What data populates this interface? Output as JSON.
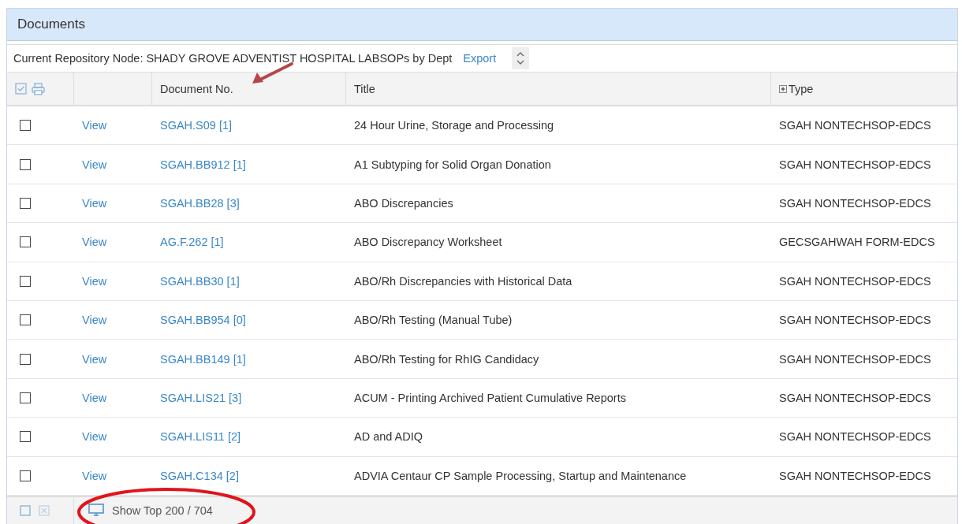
{
  "panel": {
    "title": "Documents"
  },
  "toolbar": {
    "node_label": "Current Repository Node: SHADY GROVE ADVENTIST HOSPITAL LABSOPs by Dept",
    "export_link": "Export"
  },
  "table": {
    "columns": [
      "Document No.",
      "Title",
      "Type"
    ],
    "rows": [
      {
        "checked": false,
        "action": "View",
        "doc_no": "SGAH.S09 [1]",
        "title": "24 Hour Urine, Storage and Processing",
        "type": "SGAH NONTECHSOP-EDCS"
      },
      {
        "checked": false,
        "action": "View",
        "doc_no": "SGAH.BB912 [1]",
        "title": "A1 Subtyping for Solid Organ Donation",
        "type": "SGAH NONTECHSOP-EDCS"
      },
      {
        "checked": false,
        "action": "View",
        "doc_no": "SGAH.BB28 [3]",
        "title": "ABO Discrepancies",
        "type": "SGAH NONTECHSOP-EDCS"
      },
      {
        "checked": false,
        "action": "View",
        "doc_no": "AG.F.262 [1]",
        "title": "ABO Discrepancy Worksheet",
        "type": "GECSGAHWAH FORM-EDCS"
      },
      {
        "checked": false,
        "action": "View",
        "doc_no": "SGAH.BB30 [1]",
        "title": "ABO/Rh Discrepancies with Historical Data",
        "type": "SGAH NONTECHSOP-EDCS"
      },
      {
        "checked": false,
        "action": "View",
        "doc_no": "SGAH.BB954 [0]",
        "title": "ABO/Rh Testing (Manual Tube)",
        "type": "SGAH NONTECHSOP-EDCS"
      },
      {
        "checked": false,
        "action": "View",
        "doc_no": "SGAH.BB149 [1]",
        "title": "ABO/Rh Testing for RhIG Candidacy",
        "type": "SGAH NONTECHSOP-EDCS"
      },
      {
        "checked": false,
        "action": "View",
        "doc_no": "SGAH.LIS21 [3]",
        "title": "ACUM - Printing Archived Patient Cumulative Reports",
        "type": "SGAH NONTECHSOP-EDCS"
      },
      {
        "checked": false,
        "action": "View",
        "doc_no": "SGAH.LIS11 [2]",
        "title": "AD and ADIQ",
        "type": "SGAH NONTECHSOP-EDCS"
      },
      {
        "checked": false,
        "action": "View",
        "doc_no": "SGAH.C134 [2]",
        "title": "ADVIA Centaur CP Sample Processing, Startup and Maintenance",
        "type": "SGAH NONTECHSOP-EDCS"
      }
    ]
  },
  "footer": {
    "show_top": "Show Top 200 / 704"
  }
}
